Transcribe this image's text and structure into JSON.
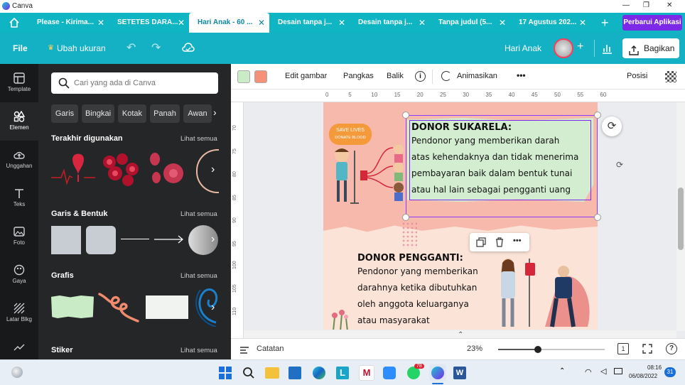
{
  "window": {
    "title": "Canva",
    "controls": [
      "—",
      "❐",
      "✕"
    ]
  },
  "tabs": [
    {
      "label": "Please - Kirima...",
      "active": false
    },
    {
      "label": "SETETES DARA...",
      "active": false
    },
    {
      "label": "Hari Anak - 60 ...",
      "active": true
    },
    {
      "label": "Desain tanpa j...",
      "active": false
    },
    {
      "label": "Desain tanpa j...",
      "active": false
    },
    {
      "label": "Tanpa judul (5...",
      "active": false
    },
    {
      "label": "17 Agustus 202...",
      "active": false
    }
  ],
  "tab_new": "+",
  "upgrade_button": "Perbarui Aplikasi",
  "topbar": {
    "file": "File",
    "resize": "Ubah ukuran",
    "doc_title": "Hari Anak",
    "share": "Bagikan"
  },
  "sidebar": [
    {
      "label": "Template",
      "icon": "template-icon"
    },
    {
      "label": "Elemen",
      "icon": "elements-icon",
      "active": true
    },
    {
      "label": "Unggahan",
      "icon": "upload-icon"
    },
    {
      "label": "Teks",
      "icon": "text-icon"
    },
    {
      "label": "Foto",
      "icon": "photo-icon"
    },
    {
      "label": "Gaya",
      "icon": "style-icon"
    },
    {
      "label": "Latar Blkg",
      "icon": "background-icon"
    }
  ],
  "panel": {
    "search_placeholder": "Cari yang ada di Canva",
    "chips": [
      "Garis",
      "Bingkai",
      "Kotak",
      "Panah",
      "Awan"
    ],
    "sections": [
      {
        "title": "Terakhir digunakan",
        "see_all": "Lihat semua"
      },
      {
        "title": "Garis & Bentuk",
        "see_all": "Lihat semua"
      },
      {
        "title": "Grafis",
        "see_all": "Lihat semua"
      },
      {
        "title": "Stiker",
        "see_all": "Lihat semua"
      }
    ]
  },
  "toolbar": {
    "colors": [
      "#c9ecc7",
      "#f79078"
    ],
    "edit": "Edit gambar",
    "crop": "Pangkas",
    "flip": "Balik",
    "animate": "Animasikan",
    "more": "•••",
    "position": "Posisi"
  },
  "ruler": {
    "h": [
      "0",
      "5",
      "10",
      "15",
      "20",
      "25",
      "30",
      "35",
      "40",
      "45",
      "50",
      "55",
      "60"
    ],
    "v": [
      "70",
      "75",
      "80",
      "85",
      "90",
      "95",
      "100",
      "105",
      "110"
    ]
  },
  "canvas": {
    "badge": [
      "SAVE LIVES",
      "DONATE BLOOD"
    ],
    "box1_title": "DONOR SUKARELA:",
    "box1_lines": [
      "Pendonor yang memberikan darah",
      "atas kehendaknya dan tidak menerima",
      "pembayaran baik dalam bentuk tunai",
      "atau hal lain sebagai pengganti uang"
    ],
    "box2_title": "DONOR PENGGANTI:",
    "box2_lines": [
      "Pendonor yang memberikan",
      "darahnya ketika dibutuhkan",
      "oleh anggota keluarganya",
      "atau masyarakat"
    ],
    "element_toolbar": "•••"
  },
  "bottombar": {
    "notes": "Catatan",
    "zoom": "23%",
    "zoom_level": 0.23,
    "pages": "1",
    "help": "?"
  },
  "taskbar": {
    "time": "08:16",
    "date": "06/08/2022",
    "badge_whatsapp": "78",
    "notif": "31"
  }
}
